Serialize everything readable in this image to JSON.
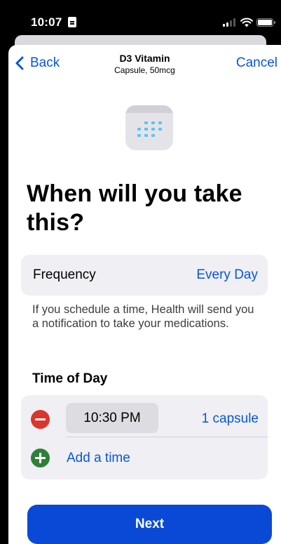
{
  "status_bar": {
    "time": "10:07",
    "icons": [
      "id-badge-icon",
      "signal-icon",
      "wifi-icon",
      "battery-icon"
    ]
  },
  "nav": {
    "back_label": "Back",
    "title": "D3 Vitamin",
    "subtitle": "Capsule, 50mcg",
    "cancel_label": "Cancel"
  },
  "header": {
    "icon": "calendar-icon",
    "title": "When will you take this?"
  },
  "frequency": {
    "label": "Frequency",
    "value": "Every Day"
  },
  "note": "If you schedule a time, Health will send you a notification to take your medications.",
  "time_of_day": {
    "title": "Time of Day",
    "entries": [
      {
        "time": "10:30 PM",
        "dose": "1 capsule"
      }
    ],
    "add_label": "Add a time"
  },
  "next_label": "Next",
  "colors": {
    "accent": "#0a56d8",
    "primary_button": "#0a49d6",
    "remove": "#d9362e",
    "add": "#2f7f3b",
    "grouped_background": "#efeff4"
  }
}
